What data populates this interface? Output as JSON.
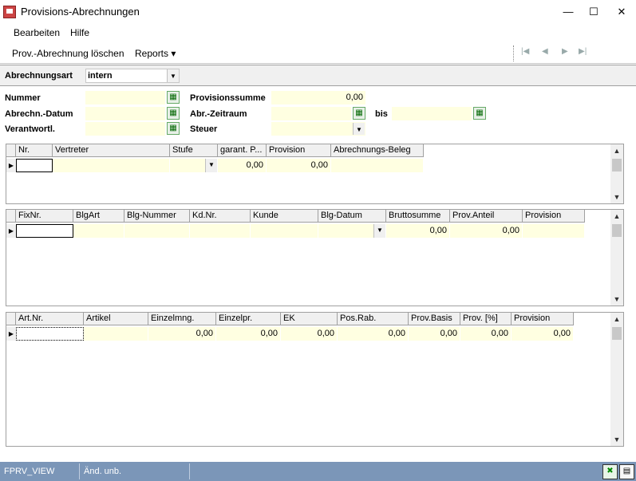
{
  "window": {
    "title": "Provisions-Abrechnungen",
    "minimize": "—",
    "maximize": "☐",
    "close": "✕"
  },
  "menu": {
    "edit": "Bearbeiten",
    "help": "Hilfe"
  },
  "toolbar": {
    "delete": "Prov.-Abrechnung löschen",
    "reports": "Reports ▾"
  },
  "nav": {
    "first": "|◀",
    "prev": "◀",
    "next": "▶",
    "last": "▶|"
  },
  "header": {
    "abrechnungsart_label": "Abrechnungsart",
    "abrechnungsart_value": "intern"
  },
  "form": {
    "nummer_label": "Nummer",
    "datum_label": "Abrechn.-Datum",
    "verantwortl_label": "Verantwortl.",
    "provsumme_label": "Provisionssumme",
    "provsumme_value": "0,00",
    "zeitraum_label": "Abr.-Zeitraum",
    "bis_label": "bis",
    "steuer_label": "Steuer"
  },
  "grid1": {
    "columns": [
      "Nr.",
      "Vertreter",
      "Stufe",
      "garant. P...",
      "Provision",
      "Abrechnungs-Beleg"
    ],
    "row": [
      "",
      "",
      "",
      "0,00",
      "0,00",
      ""
    ]
  },
  "grid2": {
    "columns": [
      "FixNr.",
      "BlgArt",
      "Blg-Nummer",
      "Kd.Nr.",
      "Kunde",
      "Blg-Datum",
      "Bruttosumme",
      "Prov.Anteil",
      "Provision"
    ],
    "row": [
      "",
      "",
      "",
      "",
      "",
      "",
      "0,00",
      "0,00",
      ""
    ]
  },
  "grid3": {
    "columns": [
      "Art.Nr.",
      "Artikel",
      "Einzelmng.",
      "Einzelpr.",
      "EK",
      "Pos.Rab.",
      "Prov.Basis",
      "Prov. [%]",
      "Provision"
    ],
    "row": [
      "",
      "",
      "0,00",
      "0,00",
      "0,00",
      "0,00",
      "0,00",
      "0,00",
      "0,00"
    ]
  },
  "status": {
    "view": "FPRV_VIEW",
    "state": "Änd. unb."
  },
  "colors": {
    "field_bg": "#ffffe1",
    "status_bg": "#7b96b8",
    "header_bg": "#f0f0f0"
  }
}
